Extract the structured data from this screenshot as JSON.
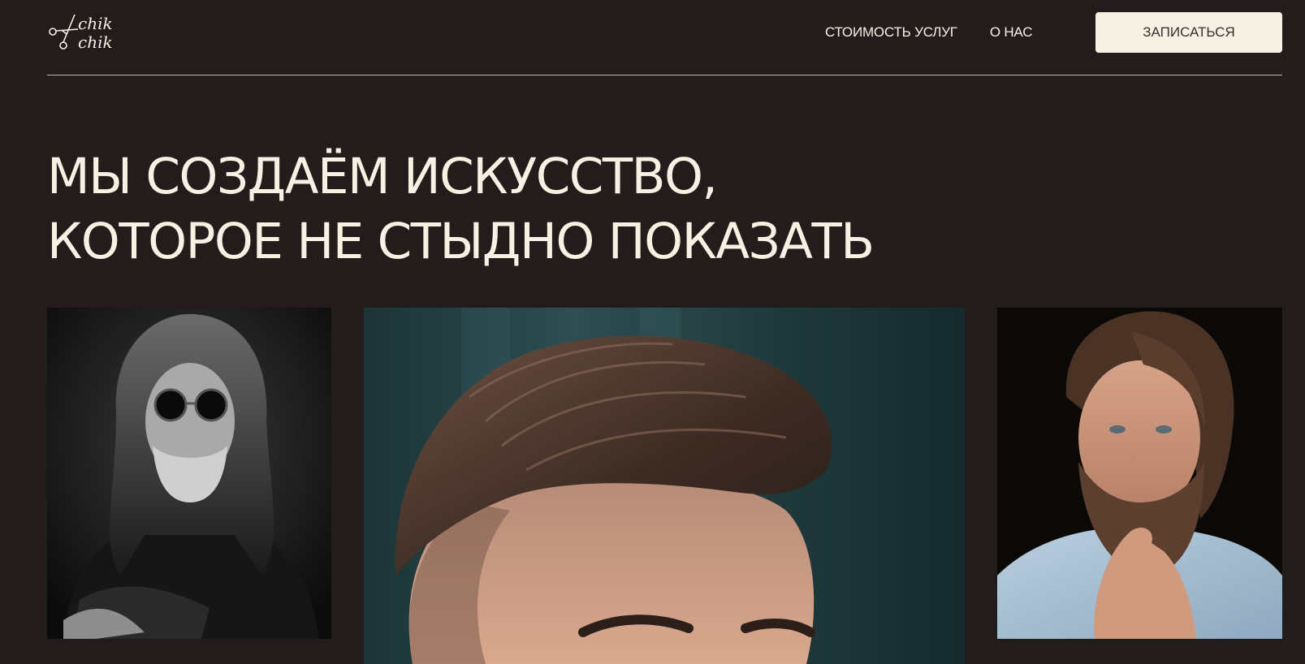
{
  "header": {
    "logo": {
      "line1": "chik",
      "line2": "chik",
      "icon": "scissors-icon"
    },
    "nav": {
      "items": [
        {
          "label": "СТОИМОСТЬ УСЛУГ"
        },
        {
          "label": "О НАС"
        }
      ]
    },
    "cta": {
      "label": "ЗАПИСАТЬСЯ"
    }
  },
  "hero": {
    "title_line1": "МЫ СОЗДАЁМ ИСКУССТВО,",
    "title_line2": "КОТОРОЕ НЕ СТЫДНО ПОКАЗАТЬ"
  },
  "gallery": {
    "photos": [
      {
        "subject": "bw-long-hair-man-with-sunglasses"
      },
      {
        "subject": "textured-quiff-haircut-closeup"
      },
      {
        "subject": "bearded-man-portrait"
      }
    ]
  },
  "colors": {
    "background": "#231c1c",
    "text": "#f5f1e3",
    "button_bg": "#f5f1e3",
    "button_text": "#3a2f2f",
    "divider": "#bdb6a9"
  }
}
